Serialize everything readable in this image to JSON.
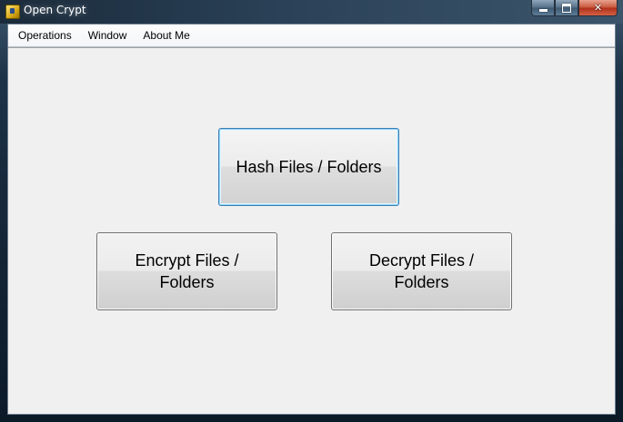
{
  "window": {
    "title": "Open Crypt",
    "icon": "app-lock-icon",
    "controls": {
      "minimize_icon": "minimize-icon",
      "maximize_icon": "maximize-icon",
      "close_glyph": "✕"
    }
  },
  "menubar": {
    "items": [
      {
        "label": "Operations"
      },
      {
        "label": "Window"
      },
      {
        "label": "About Me"
      }
    ]
  },
  "main": {
    "buttons": {
      "hash": "Hash Files / Folders",
      "encrypt": "Encrypt Files / Folders",
      "decrypt": "Decrypt Files / Folders"
    }
  },
  "colors": {
    "client_bg": "#f0f0f0",
    "focus_border": "#3c7fb1",
    "close_button": "#c8583e"
  }
}
